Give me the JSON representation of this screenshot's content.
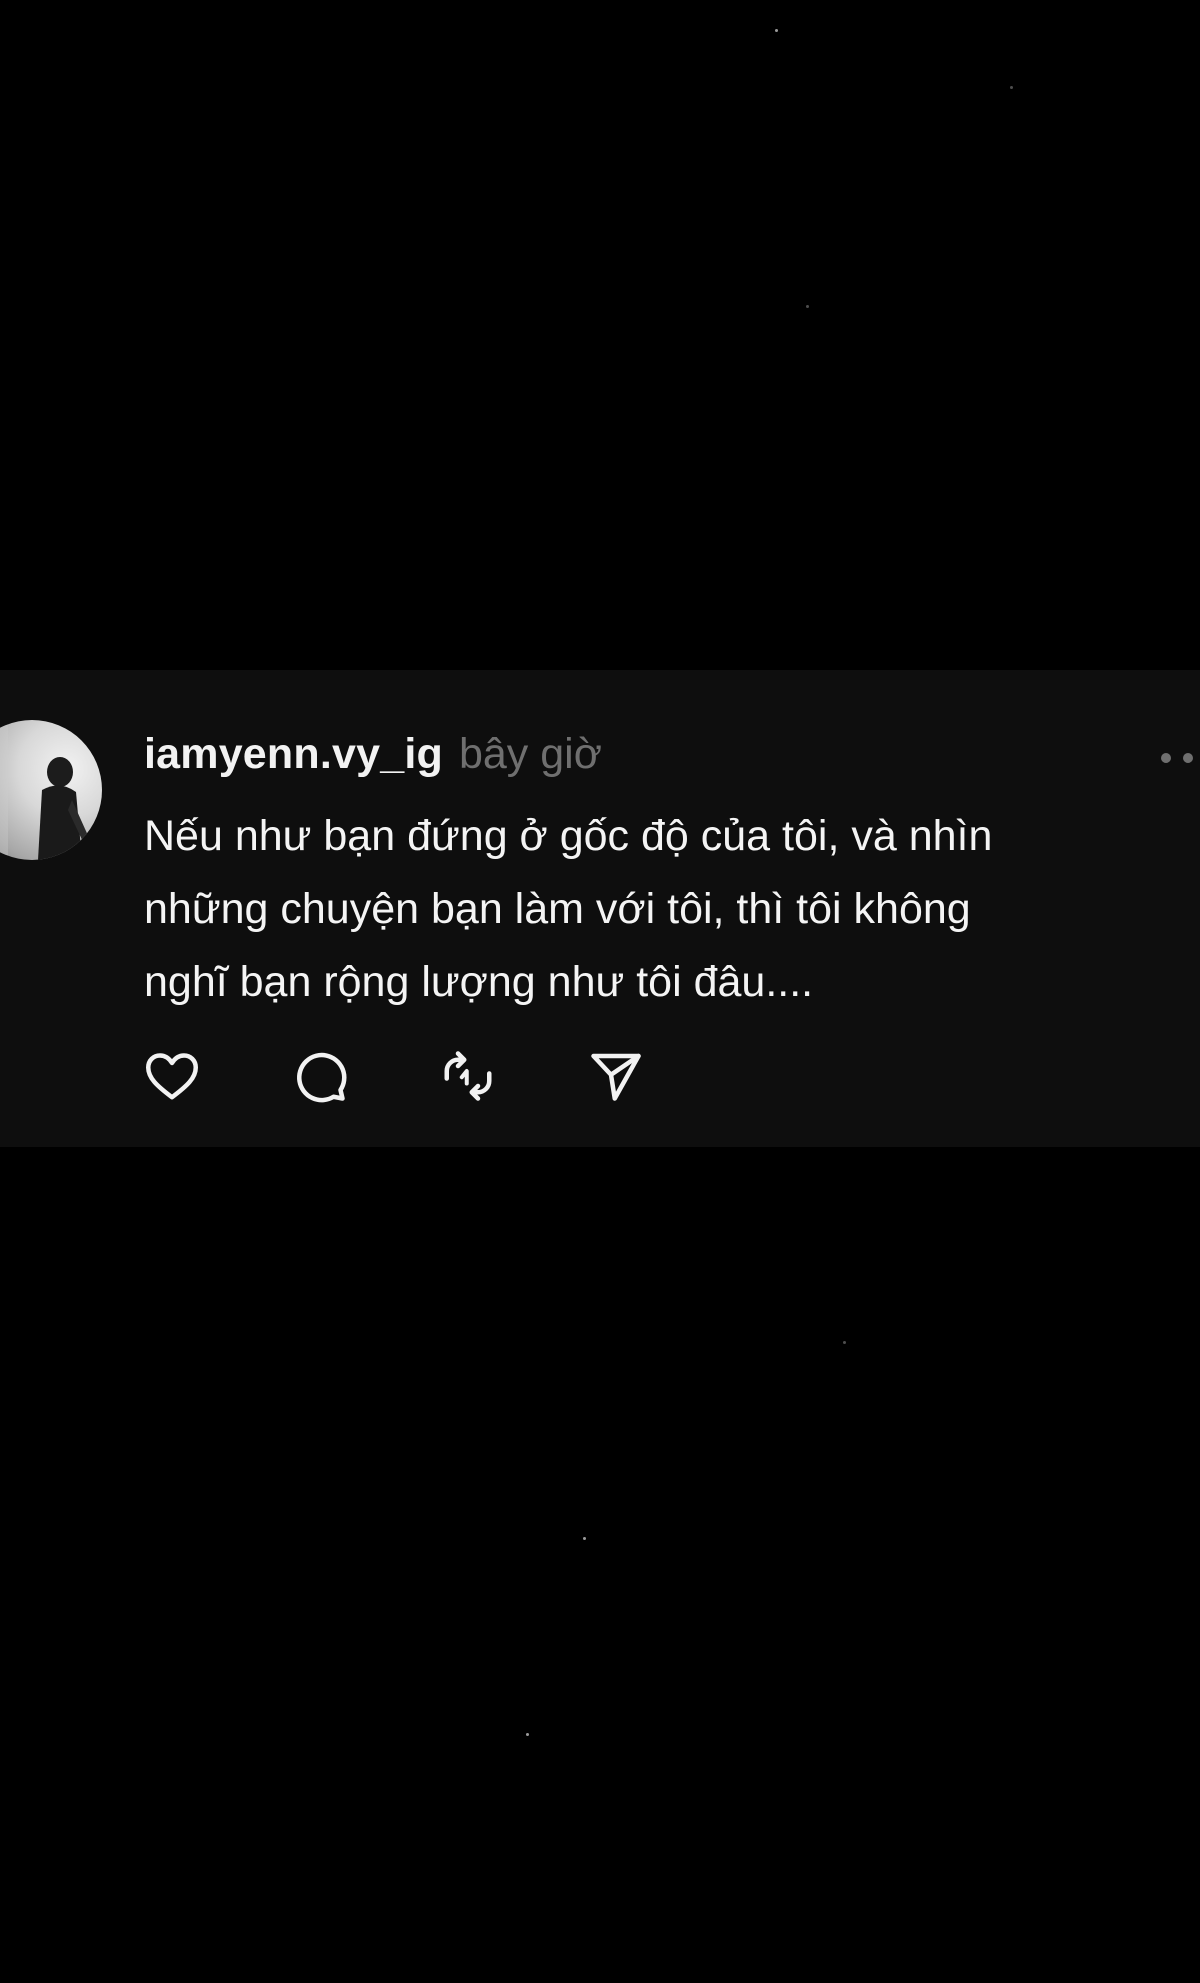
{
  "post": {
    "username": "iamyenn.vy_ig",
    "timestamp": "bây giờ",
    "text": "Nếu như bạn đứng ở gốc độ của tôi, và nhìn\nnhững chuyện bạn làm với tôi, thì tôi không\nnghĩ bạn rộng lượng như tôi đâu....",
    "more_icon": "more-horizontal-icon",
    "actions": [
      {
        "name": "like",
        "icon": "heart-icon"
      },
      {
        "name": "comment",
        "icon": "comment-bubble-icon"
      },
      {
        "name": "repost",
        "icon": "repost-icon"
      },
      {
        "name": "share",
        "icon": "send-icon"
      }
    ]
  },
  "colors": {
    "background": "#000000",
    "card_background": "#0e0e0e",
    "primary_text": "#f2f2f2",
    "secondary_text": "#6f6f6f"
  }
}
